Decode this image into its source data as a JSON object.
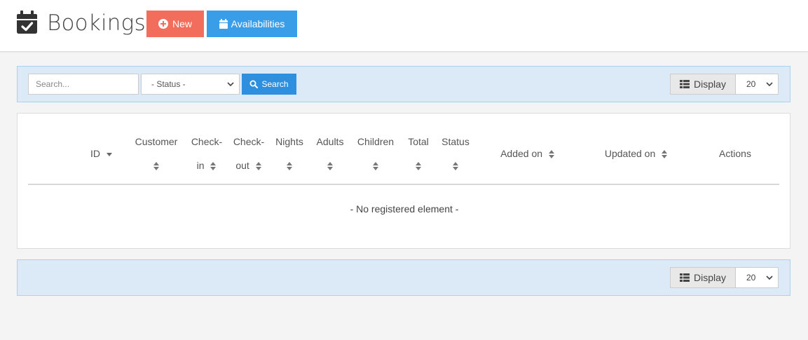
{
  "header": {
    "title": "Bookings",
    "new_label": "New",
    "availabilities_label": "Availabilities"
  },
  "filters": {
    "search_placeholder": "Search...",
    "status_selected": "- Status -",
    "search_button": "Search"
  },
  "display": {
    "label": "Display",
    "per_page": "20"
  },
  "table": {
    "columns": {
      "id": "ID",
      "customer": "Customer",
      "checkin_top": "Check-",
      "checkin_bottom": "in",
      "checkout_top": "Check-",
      "checkout_bottom": "out",
      "nights": "Nights",
      "adults": "Adults",
      "children": "Children",
      "total": "Total",
      "status": "Status",
      "added_on": "Added on",
      "updated_on": "Updated on",
      "actions": "Actions"
    },
    "empty_message": "- No registered element -"
  },
  "colors": {
    "new_button": "#f26d5b",
    "availabilities_button": "#3a9de8",
    "search_button": "#2d8fde",
    "toolbar_bg": "#dbeaf6"
  }
}
